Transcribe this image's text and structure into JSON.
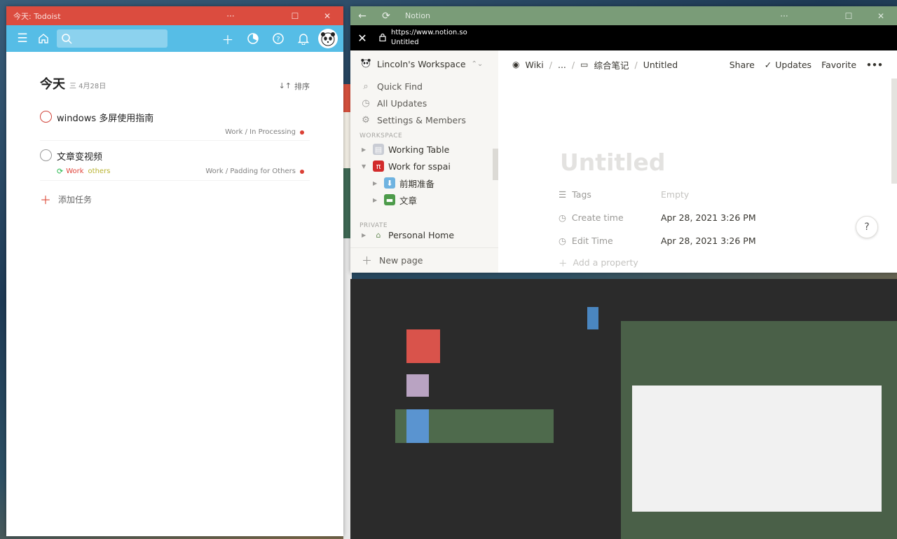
{
  "todoist": {
    "window_title": "今天: Todoist",
    "header_title": "今天",
    "header_date": "三 4月28日",
    "sort_label": "排序",
    "tasks": [
      {
        "text": "windows 多屏使用指南",
        "project": "Work / In Processing",
        "labels": []
      },
      {
        "text": "文章变视频",
        "project": "Work / Padding for Others",
        "labels": [
          "Work",
          "others"
        ]
      }
    ],
    "add_task_label": "添加任务",
    "brand_color": "#db4c3f",
    "toolbar_color": "#56bde6"
  },
  "notion": {
    "window_title": "Notion",
    "url": "https://www.notion.so",
    "url_page_title": "Untitled",
    "workspace_name": "Lincoln's Workspace",
    "sidebar_actions": [
      "Quick Find",
      "All Updates",
      "Settings & Members"
    ],
    "section_workspace": "WORKSPACE",
    "section_private": "PRIVATE",
    "tree": [
      {
        "label": "Working Table",
        "level": 0,
        "expanded": false
      },
      {
        "label": "Work for sspai",
        "level": 0,
        "expanded": true
      },
      {
        "label": "前期准备",
        "level": 1,
        "expanded": false
      },
      {
        "label": "文章",
        "level": 1,
        "expanded": false
      }
    ],
    "private_tree": [
      {
        "label": "Personal Home"
      }
    ],
    "new_page_label": "New page",
    "breadcrumb": [
      "Wiki",
      "...",
      "综合笔记",
      "Untitled"
    ],
    "actions": {
      "share": "Share",
      "updates": "Updates",
      "favorite": "Favorite",
      "more": "•••"
    },
    "page_title": "Untitled",
    "properties": [
      {
        "name": "Tags",
        "value": "Empty",
        "empty": true
      },
      {
        "name": "Create time",
        "value": "Apr 28, 2021 3:26 PM",
        "empty": false
      },
      {
        "name": "Edit Time",
        "value": "Apr 28, 2021 3:26 PM",
        "empty": false
      }
    ],
    "add_property_label": "Add a property",
    "help_label": "?",
    "titlebar_color": "#7a9c78"
  }
}
